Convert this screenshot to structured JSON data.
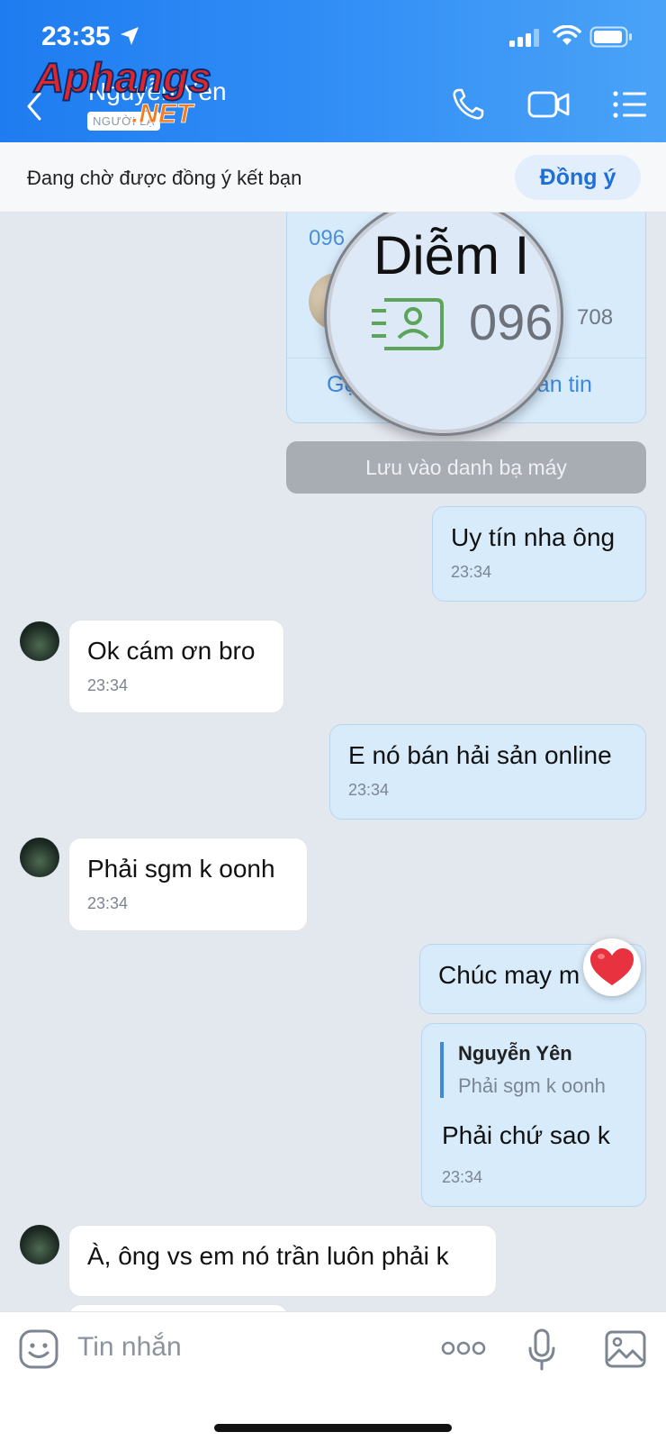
{
  "status_bar": {
    "time": "23:35"
  },
  "header": {
    "contact_name": "Nguyễn Yên",
    "badge": "NGƯỜI LẠ",
    "watermark_line1": "Aphangs",
    "watermark_line2": ".NET"
  },
  "friend_request": {
    "text": "Đang chờ được đồng ý kết bạn",
    "accept_label": "Đồng ý"
  },
  "contact_card": {
    "phone_top": "096",
    "phone_right": "708",
    "call_label": "Gọi",
    "message_label": "nhắn tin",
    "magnified_name": "Diễm I",
    "magnified_phone": "096",
    "save_label": "Lưu vào danh bạ máy"
  },
  "messages": [
    {
      "text": "Uy tín nha ông",
      "time": "23:34"
    },
    {
      "text": "Ok cám ơn bro",
      "time": "23:34"
    },
    {
      "text": "E nó bán hải sản online",
      "time": "23:34"
    },
    {
      "text": "Phải sgm k oonh",
      "time": "23:34"
    },
    {
      "text": "Chúc may m"
    },
    {
      "reply_name": "Nguyễn Yên",
      "reply_quote": "Phải sgm k oonh",
      "text": "Phải chứ sao k",
      "time": "23:34"
    },
    {
      "text": "À, ông vs em nó trần luôn phải k"
    }
  ],
  "reaction": "heart",
  "input": {
    "placeholder": "Tin nhắn"
  },
  "icons": [
    "back-icon",
    "phone-icon",
    "video-icon",
    "menu-icon",
    "sticker-icon",
    "more-icon",
    "microphone-icon",
    "image-icon"
  ],
  "colors": {
    "header": "#1f7cf0",
    "my_bubble": "#d8ebfb",
    "link": "#3b88dd",
    "heart": "#e8323f"
  }
}
